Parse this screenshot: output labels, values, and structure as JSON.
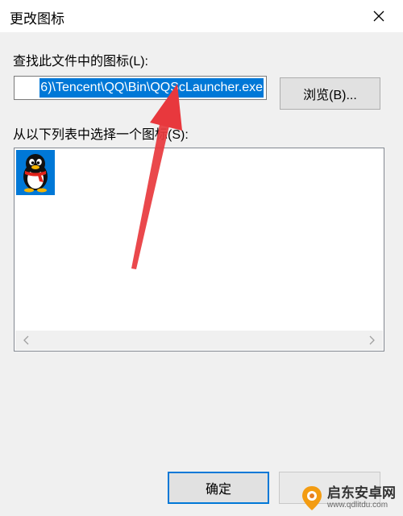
{
  "window": {
    "title": "更改图标",
    "close_icon": "close-icon"
  },
  "file_section": {
    "label": "查找此文件中的图标(L):",
    "path_value": "6)\\Tencent\\QQ\\Bin\\QQScLauncher.exe",
    "browse_label": "浏览(B)..."
  },
  "icon_section": {
    "label": "从以下列表中选择一个图标(S):",
    "icons": [
      {
        "name": "qq-penguin-icon",
        "selected": true
      }
    ]
  },
  "footer": {
    "ok_label": "确定",
    "cancel_label": ""
  },
  "watermark": {
    "main": "启东安卓网",
    "sub": "www.qdlitdu.com"
  },
  "colors": {
    "accent": "#0078d7",
    "annotation_arrow": "#e8383d"
  }
}
